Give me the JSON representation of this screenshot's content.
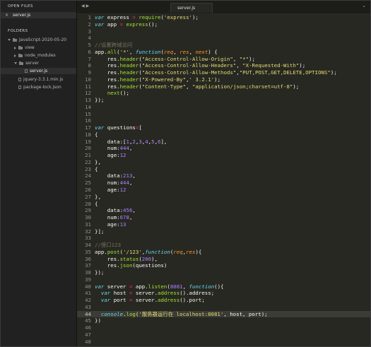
{
  "sidebar": {
    "open_files_title": "OPEN FILES",
    "open_files": [
      {
        "name": "server.js",
        "close_glyph": "×"
      }
    ],
    "folders_title": "FOLDERS",
    "tree": [
      {
        "name": "JavaScript-2020-05-20",
        "depth": 0,
        "kind": "folder",
        "expanded": true
      },
      {
        "name": "view",
        "depth": 1,
        "kind": "folder",
        "expanded": false
      },
      {
        "name": "node_modules",
        "depth": 1,
        "kind": "folder",
        "expanded": false
      },
      {
        "name": "server",
        "depth": 1,
        "kind": "folder",
        "expanded": true
      },
      {
        "name": "server.js",
        "depth": 2,
        "kind": "file",
        "selected": true
      },
      {
        "name": "jquery-3.3.1.min.js",
        "depth": 1,
        "kind": "file"
      },
      {
        "name": "package-lock.json",
        "depth": 1,
        "kind": "file"
      }
    ]
  },
  "tabbar": {
    "back_glyph": "◀",
    "forward_glyph": "▶",
    "active_tab": "server.js",
    "dropdown_glyph": "⌄"
  },
  "editor": {
    "current_line": 44,
    "lines": [
      [
        [
          "k",
          "var"
        ],
        [
          "t",
          " express "
        ],
        [
          "o",
          "="
        ],
        [
          "t",
          " "
        ],
        [
          "f",
          "require"
        ],
        [
          "t",
          "("
        ],
        [
          "s",
          "'express'"
        ],
        [
          "t",
          ");"
        ]
      ],
      [
        [
          "k",
          "var"
        ],
        [
          "t",
          " app "
        ],
        [
          "o",
          "="
        ],
        [
          "t",
          " "
        ],
        [
          "f",
          "express"
        ],
        [
          "t",
          "();"
        ]
      ],
      [],
      [],
      [
        [
          "c",
          "//设置跨域访问"
        ]
      ],
      [
        [
          "t",
          "app."
        ],
        [
          "f",
          "all"
        ],
        [
          "t",
          "("
        ],
        [
          "s",
          "'*'"
        ],
        [
          "t",
          ", "
        ],
        [
          "k",
          "function"
        ],
        [
          "t",
          "("
        ],
        [
          "p",
          "req"
        ],
        [
          "t",
          ", "
        ],
        [
          "p",
          "res"
        ],
        [
          "t",
          ", "
        ],
        [
          "p",
          "next"
        ],
        [
          "t",
          ") {"
        ]
      ],
      [
        [
          "t",
          "    res."
        ],
        [
          "f",
          "header"
        ],
        [
          "t",
          "("
        ],
        [
          "s",
          "\"Access-Control-Allow-Origin\""
        ],
        [
          "t",
          ", "
        ],
        [
          "s",
          "\"*\""
        ],
        [
          "t",
          ");"
        ]
      ],
      [
        [
          "t",
          "    res."
        ],
        [
          "f",
          "header"
        ],
        [
          "t",
          "("
        ],
        [
          "s",
          "\"Access-Control-Allow-Headers\""
        ],
        [
          "t",
          ", "
        ],
        [
          "s",
          "\"X-Requested-With\""
        ],
        [
          "t",
          ");"
        ]
      ],
      [
        [
          "t",
          "    res."
        ],
        [
          "f",
          "header"
        ],
        [
          "t",
          "("
        ],
        [
          "s",
          "\"Access-Control-Allow-Methods\""
        ],
        [
          "t",
          ","
        ],
        [
          "s",
          "\"PUT,POST,GET,DELETE,OPTIONS\""
        ],
        [
          "t",
          ");"
        ]
      ],
      [
        [
          "t",
          "    res."
        ],
        [
          "f",
          "header"
        ],
        [
          "t",
          "("
        ],
        [
          "s",
          "\"X-Powered-By\""
        ],
        [
          "t",
          ","
        ],
        [
          "s",
          "' 3.2.1'"
        ],
        [
          "t",
          ");"
        ]
      ],
      [
        [
          "t",
          "    res."
        ],
        [
          "f",
          "header"
        ],
        [
          "t",
          "("
        ],
        [
          "s",
          "\"Content-Type\""
        ],
        [
          "t",
          ", "
        ],
        [
          "s",
          "\"application/json;charset=utf-8\""
        ],
        [
          "t",
          ");"
        ]
      ],
      [
        [
          "t",
          "    "
        ],
        [
          "f",
          "next"
        ],
        [
          "t",
          "();"
        ]
      ],
      [
        [
          "t",
          "});"
        ]
      ],
      [],
      [],
      [],
      [
        [
          "k",
          "var"
        ],
        [
          "t",
          " questions"
        ],
        [
          "o",
          "="
        ],
        [
          "t",
          "["
        ]
      ],
      [
        [
          "t",
          "{"
        ]
      ],
      [
        [
          "t",
          "    data:["
        ],
        [
          "n",
          "1"
        ],
        [
          "t",
          ","
        ],
        [
          "n",
          "2"
        ],
        [
          "t",
          ","
        ],
        [
          "n",
          "3"
        ],
        [
          "t",
          ","
        ],
        [
          "n",
          "4"
        ],
        [
          "t",
          ","
        ],
        [
          "n",
          "5"
        ],
        [
          "t",
          ","
        ],
        [
          "n",
          "6"
        ],
        [
          "t",
          "],"
        ]
      ],
      [
        [
          "t",
          "    num:"
        ],
        [
          "n",
          "444"
        ],
        [
          "t",
          ","
        ]
      ],
      [
        [
          "t",
          "    age:"
        ],
        [
          "n",
          "12"
        ]
      ],
      [
        [
          "t",
          "},"
        ]
      ],
      [
        [
          "t",
          "{"
        ]
      ],
      [
        [
          "t",
          "    data:"
        ],
        [
          "n",
          "213"
        ],
        [
          "t",
          ","
        ]
      ],
      [
        [
          "t",
          "    num:"
        ],
        [
          "n",
          "444"
        ],
        [
          "t",
          ","
        ]
      ],
      [
        [
          "t",
          "    age:"
        ],
        [
          "n",
          "12"
        ]
      ],
      [
        [
          "t",
          "},"
        ]
      ],
      [
        [
          "t",
          "{"
        ]
      ],
      [
        [
          "t",
          "    data:"
        ],
        [
          "n",
          "456"
        ],
        [
          "t",
          ","
        ]
      ],
      [
        [
          "t",
          "    num:"
        ],
        [
          "n",
          "678"
        ],
        [
          "t",
          ","
        ]
      ],
      [
        [
          "t",
          "    age:"
        ],
        [
          "n",
          "13"
        ]
      ],
      [
        [
          "t",
          "}];"
        ]
      ],
      [],
      [
        [
          "c",
          "//接口123"
        ]
      ],
      [
        [
          "t",
          "app."
        ],
        [
          "f",
          "post"
        ],
        [
          "t",
          "("
        ],
        [
          "s",
          "'/123'"
        ],
        [
          "t",
          ","
        ],
        [
          "k",
          "function"
        ],
        [
          "t",
          "("
        ],
        [
          "p",
          "req"
        ],
        [
          "t",
          ","
        ],
        [
          "p",
          "res"
        ],
        [
          "t",
          "){"
        ]
      ],
      [
        [
          "t",
          "    res."
        ],
        [
          "f",
          "status"
        ],
        [
          "t",
          "("
        ],
        [
          "n",
          "200"
        ],
        [
          "t",
          "),"
        ]
      ],
      [
        [
          "t",
          "    res."
        ],
        [
          "f",
          "json"
        ],
        [
          "t",
          "(questions)"
        ]
      ],
      [
        [
          "t",
          "});"
        ]
      ],
      [],
      [
        [
          "k",
          "var"
        ],
        [
          "t",
          " server "
        ],
        [
          "o",
          "="
        ],
        [
          "t",
          " app."
        ],
        [
          "f",
          "listen"
        ],
        [
          "t",
          "("
        ],
        [
          "n",
          "8081"
        ],
        [
          "t",
          ", "
        ],
        [
          "k",
          "function"
        ],
        [
          "t",
          "(){"
        ]
      ],
      [
        [
          "t",
          "  "
        ],
        [
          "k",
          "var"
        ],
        [
          "t",
          " host "
        ],
        [
          "o",
          "="
        ],
        [
          "t",
          " server."
        ],
        [
          "f",
          "address"
        ],
        [
          "t",
          "().address;"
        ]
      ],
      [
        [
          "t",
          "  "
        ],
        [
          "k",
          "var"
        ],
        [
          "t",
          " port "
        ],
        [
          "o",
          "="
        ],
        [
          "t",
          " server."
        ],
        [
          "f",
          "address"
        ],
        [
          "t",
          "().port;"
        ]
      ],
      [],
      [
        [
          "t",
          "  "
        ],
        [
          "k",
          "console"
        ],
        [
          "t",
          "."
        ],
        [
          "f",
          "log"
        ],
        [
          "t",
          "("
        ],
        [
          "s",
          "'服务器运行在 localhost:8081'"
        ],
        [
          "t",
          ", host, port);"
        ]
      ],
      [
        [
          "t",
          "})"
        ]
      ],
      [],
      [],
      []
    ]
  },
  "colors": {
    "background": "#272822",
    "keyword": "#66d9ef",
    "string": "#e6db74",
    "number": "#ae81ff",
    "function": "#a6e22e",
    "comment": "#75715e",
    "operator": "#f92672"
  }
}
